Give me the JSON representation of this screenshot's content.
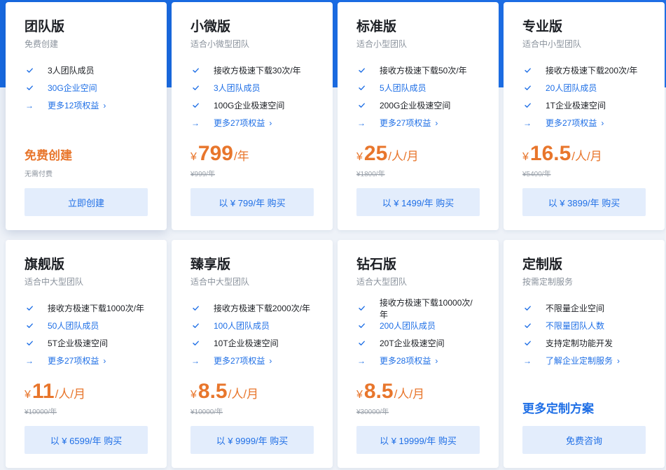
{
  "colors": {
    "accent": "#1f6fe6",
    "price": "#e8762c",
    "button_bg": "#e3edfc",
    "header_bg": "#1769e0"
  },
  "plans": [
    {
      "id": "team",
      "title": "团队版",
      "subtitle": "免费创建",
      "features": [
        {
          "text": "3人团队成员",
          "style": "normal",
          "icon": "check-icon"
        },
        {
          "text": "30G企业空间",
          "style": "blue",
          "icon": "check-icon"
        },
        {
          "text": "更多12项权益",
          "style": "more",
          "icon": "arrow-right-icon"
        }
      ],
      "free_title": "免费创建",
      "free_note": "无需付费",
      "button": "立即创建"
    },
    {
      "id": "micro",
      "title": "小微版",
      "subtitle": "适合小微型团队",
      "features": [
        {
          "text": "接收方极速下载30次/年",
          "style": "normal",
          "icon": "check-icon"
        },
        {
          "text": "3人团队成员",
          "style": "blue",
          "icon": "check-icon"
        },
        {
          "text": "100G企业极速空间",
          "style": "normal",
          "icon": "check-icon"
        },
        {
          "text": "更多27项权益",
          "style": "more",
          "icon": "arrow-right-icon"
        }
      ],
      "price": {
        "currency": "¥",
        "amount": "799",
        "unit": "/年",
        "original": "¥999/年"
      },
      "button": "以 ¥ 799/年 购买"
    },
    {
      "id": "standard",
      "title": "标准版",
      "subtitle": "适合小型团队",
      "features": [
        {
          "text": "接收方极速下载50次/年",
          "style": "normal",
          "icon": "check-icon"
        },
        {
          "text": "5人团队成员",
          "style": "blue",
          "icon": "check-icon"
        },
        {
          "text": "200G企业极速空间",
          "style": "normal",
          "icon": "check-icon"
        },
        {
          "text": "更多27项权益",
          "style": "more",
          "icon": "arrow-right-icon"
        }
      ],
      "price": {
        "currency": "¥",
        "amount": "25",
        "unit": "/人/月",
        "original": "¥1800/年"
      },
      "button": "以 ¥ 1499/年 购买"
    },
    {
      "id": "pro",
      "title": "专业版",
      "subtitle": "适合中小型团队",
      "features": [
        {
          "text": "接收方极速下载200次/年",
          "style": "normal",
          "icon": "check-icon"
        },
        {
          "text": "20人团队成员",
          "style": "blue",
          "icon": "check-icon"
        },
        {
          "text": "1T企业极速空间",
          "style": "normal",
          "icon": "check-icon"
        },
        {
          "text": "更多27项权益",
          "style": "more",
          "icon": "arrow-right-icon"
        }
      ],
      "price": {
        "currency": "¥",
        "amount": "16.5",
        "unit": "/人/月",
        "original": "¥5400/年"
      },
      "button": "以 ¥ 3899/年 购买"
    },
    {
      "id": "flagship",
      "title": "旗舰版",
      "subtitle": "适合中大型团队",
      "features": [
        {
          "text": "接收方极速下载1000次/年",
          "style": "normal",
          "icon": "check-icon"
        },
        {
          "text": "50人团队成员",
          "style": "blue",
          "icon": "check-icon"
        },
        {
          "text": "5T企业极速空间",
          "style": "normal",
          "icon": "check-icon"
        },
        {
          "text": "更多27项权益",
          "style": "more",
          "icon": "arrow-right-icon"
        }
      ],
      "price": {
        "currency": "¥",
        "amount": "11",
        "unit": "/人/月",
        "original": "¥10000/年"
      },
      "button": "以 ¥ 6599/年 购买"
    },
    {
      "id": "premium",
      "title": "臻享版",
      "subtitle": "适合中大型团队",
      "features": [
        {
          "text": "接收方极速下载2000次/年",
          "style": "normal",
          "icon": "check-icon"
        },
        {
          "text": "100人团队成员",
          "style": "blue",
          "icon": "check-icon"
        },
        {
          "text": "10T企业极速空间",
          "style": "normal",
          "icon": "check-icon"
        },
        {
          "text": "更多27项权益",
          "style": "more",
          "icon": "arrow-right-icon"
        }
      ],
      "price": {
        "currency": "¥",
        "amount": "8.5",
        "unit": "/人/月",
        "original": "¥10000/年"
      },
      "button": "以 ¥ 9999/年 购买"
    },
    {
      "id": "diamond",
      "title": "钻石版",
      "subtitle": "适合大型团队",
      "features": [
        {
          "text": "接收方极速下载10000次/年",
          "style": "normal",
          "icon": "check-icon"
        },
        {
          "text": "200人团队成员",
          "style": "blue",
          "icon": "check-icon"
        },
        {
          "text": "20T企业极速空间",
          "style": "normal",
          "icon": "check-icon"
        },
        {
          "text": "更多28项权益",
          "style": "more",
          "icon": "arrow-right-icon"
        }
      ],
      "price": {
        "currency": "¥",
        "amount": "8.5",
        "unit": "/人/月",
        "original": "¥30000/年"
      },
      "button": "以 ¥ 19999/年 购买"
    },
    {
      "id": "custom",
      "title": "定制版",
      "subtitle": "按需定制服务",
      "features": [
        {
          "text": "不限量企业空间",
          "style": "normal",
          "icon": "check-icon"
        },
        {
          "text": "不限量团队人数",
          "style": "blue",
          "icon": "check-icon"
        },
        {
          "text": "支持定制功能开发",
          "style": "normal",
          "icon": "check-icon"
        },
        {
          "text": "了解企业定制服务",
          "style": "more",
          "icon": "arrow-right-icon"
        }
      ],
      "custom_title": "更多定制方案",
      "button": "免费咨询"
    }
  ]
}
